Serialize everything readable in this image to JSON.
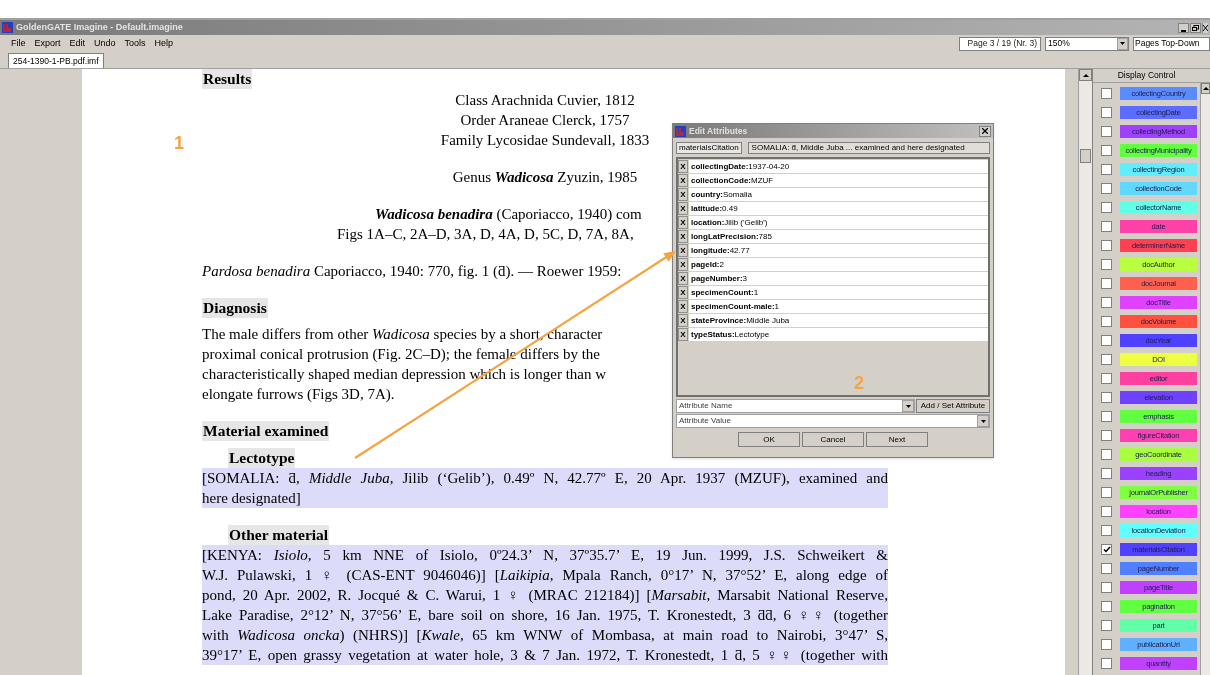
{
  "window": {
    "title": "GoldenGATE Imagine - Default.imagine"
  },
  "menu": [
    "File",
    "Export",
    "Edit",
    "Undo",
    "Tools",
    "Help"
  ],
  "toolbar": {
    "page_field": "Page 3 / 19 (Nr. 3)",
    "zoom": "150%",
    "layout": "Pages Top-Down"
  },
  "tabs": [
    {
      "label": "254-1390-1-PB.pdf.imf",
      "selected": true
    }
  ],
  "document": {
    "blocks": [
      {
        "kind": "heading",
        "lines": [
          "Results"
        ]
      },
      {
        "kind": "centered",
        "lines": [
          "Class Arachnida Cuvier, 1812",
          "Order Araneae Clerck, 1757",
          "Family Lycosidae Sundevall, 1833"
        ]
      },
      {
        "kind": "centered",
        "lines": [
          "Genus **Wadicosa** Zyuzin, 1985"
        ]
      },
      {
        "kind": "offset",
        "lines": [
          "**Wadicosa benadira** (Caporiacco, 1940) com",
          "Figs 1A–C, 2A–D, 3A, D, 4A, D, 5C, D, 7A, 8A,"
        ]
      },
      {
        "kind": "paragraph",
        "highlighted": false,
        "lines": [
          "*Pardosa benadira* Caporiacco, 1940: 770, fig. 1 (ƌ). — Roewer 1959:"
        ]
      },
      {
        "kind": "heading",
        "lines": [
          "Diagnosis"
        ]
      },
      {
        "kind": "paragraph",
        "highlighted": false,
        "lines": [
          "The male differs from other *Wadicosa* species by a short, character",
          "proximal conical protrusion (Fig. 2C–D); the female differs by the",
          "characteristically shaped median depression which is longer than w",
          "elongate furrows (Figs 3D, 7A)."
        ]
      },
      {
        "kind": "heading",
        "lines": [
          "Material examined"
        ]
      },
      {
        "kind": "subheading",
        "lines": [
          "Lectotype"
        ]
      },
      {
        "kind": "paragraph",
        "highlighted": true,
        "lines": [
          "[SOMALIA: ƌ, *Middle Juba*, Jilib (‘Gelib’), 0.49º N, 42.77º E, 20 Apr. 1937 (MZUF), examined and",
          "here designated]"
        ]
      },
      {
        "kind": "subheading",
        "lines": [
          "Other material"
        ]
      },
      {
        "kind": "paragraph",
        "highlighted": true,
        "lines": [
          "[KENYA: *Isiolo*, 5 km NNE of Isiolo, 0º24.3’ N, 37º35.7’ E, 19 Jun. 1999, J.S. Schweikert &",
          "W.J. Pulawski, 1 ♀ (CAS-ENT 9046046)] [*Laikipia*, Mpala Ranch, 0°17’ N, 37°52’ E, along edge of",
          "pond, 20 Apr. 2002, R. Jocqué & C. Warui, 1 ♀ (MRAC 212184)] [*Marsabit*, Marsabit National Reserve,",
          "Lake Paradise, 2°12’ N, 37°56’ E, bare soil on shore, 16 Jan. 1975, T. Kronestedt, 3 ƌƌ, 6 ♀♀ (together",
          "with *Wadicosa oncka*) (NHRS)] [*Kwale*, 65 km WNW of Mombasa, at main road to Nairobi, 3°47’ S,",
          "39°17’ E, open grassy vegetation at water hole, 3 & 7 Jan. 1972, T. Kronestedt, 1 ƌ, 5 ♀♀ (together with"
        ]
      }
    ]
  },
  "markers": [
    "1",
    "2"
  ],
  "dialog": {
    "title": "Edit Attributes",
    "annotation_type": "materialsCitation",
    "annotation_value": "SOMALIA: ƌ, Middle Juba ... examined and here designated",
    "attributes": [
      {
        "remove": "X",
        "name": "collectingDate:",
        "value": "1937-04-20"
      },
      {
        "remove": "X",
        "name": "collectionCode:",
        "value": "MZUF"
      },
      {
        "remove": "X",
        "name": "country:",
        "value": "Somalia"
      },
      {
        "remove": "X",
        "name": "latitude:",
        "value": "0.49"
      },
      {
        "remove": "X",
        "name": "location:",
        "value": "Jilib ('Gelib')"
      },
      {
        "remove": "X",
        "name": "longLatPrecision:",
        "value": "785"
      },
      {
        "remove": "X",
        "name": "longitude:",
        "value": "42.77"
      },
      {
        "remove": "X",
        "name": "pageId:",
        "value": "2"
      },
      {
        "remove": "X",
        "name": "pageNumber:",
        "value": "3"
      },
      {
        "remove": "X",
        "name": "specimenCount:",
        "value": "1"
      },
      {
        "remove": "X",
        "name": "specimenCount-male:",
        "value": "1"
      },
      {
        "remove": "X",
        "name": "stateProvince:",
        "value": "Middle Juba"
      },
      {
        "remove": "X",
        "name": "typeStatus:",
        "value": "Lectotype"
      }
    ],
    "name_placeholder": "Attribute Name",
    "value_placeholder": "Attribute Value",
    "add_button": "Add / Set Attribute",
    "buttons": [
      "OK",
      "Cancel",
      "Next"
    ]
  },
  "display_control": {
    "title": "Display Control",
    "items": [
      {
        "label": "collectingCountry",
        "color": "#5b8cff",
        "checked": false
      },
      {
        "label": "collectingDate",
        "color": "#5c6cff",
        "checked": false
      },
      {
        "label": "collectingMethod",
        "color": "#a040ff",
        "checked": false
      },
      {
        "label": "collectingMunicipality",
        "color": "#60ff40",
        "checked": false
      },
      {
        "label": "collectingRegion",
        "color": "#60eeff",
        "checked": false
      },
      {
        "label": "collectionCode",
        "color": "#60d8ff",
        "checked": false
      },
      {
        "label": "collectorName",
        "color": "#60ffe8",
        "checked": false
      },
      {
        "label": "date",
        "color": "#ff40a8",
        "checked": false
      },
      {
        "label": "determinerName",
        "color": "#ff4050",
        "checked": false
      },
      {
        "label": "docAuthor",
        "color": "#b8ff40",
        "checked": false
      },
      {
        "label": "docJournal",
        "color": "#ff6050",
        "checked": false
      },
      {
        "label": "docTitle",
        "color": "#e040ff",
        "checked": false
      },
      {
        "label": "docVolume",
        "color": "#ff5040",
        "checked": false
      },
      {
        "label": "docYear",
        "color": "#5040ff",
        "checked": false
      },
      {
        "label": "DOI",
        "color": "#ecff40",
        "checked": false
      },
      {
        "label": "editor",
        "color": "#ff40a0",
        "checked": false
      },
      {
        "label": "elevation",
        "color": "#7040ff",
        "checked": false
      },
      {
        "label": "emphasis",
        "color": "#60ff40",
        "checked": false
      },
      {
        "label": "figureCitation",
        "color": "#ff40b0",
        "checked": false
      },
      {
        "label": "geoCoordinate",
        "color": "#a8ff40",
        "checked": false
      },
      {
        "label": "heading",
        "color": "#9a40ff",
        "checked": false
      },
      {
        "label": "journalOrPublisher",
        "color": "#80ff40",
        "checked": false
      },
      {
        "label": "location",
        "color": "#ff40ff",
        "checked": false
      },
      {
        "label": "locationDeviation",
        "color": "#60ffff",
        "checked": false
      },
      {
        "label": "materialsCitation",
        "color": "#5040ff",
        "checked": true
      },
      {
        "label": "pageNumber",
        "color": "#5080ff",
        "checked": false
      },
      {
        "label": "pageTitle",
        "color": "#c040ff",
        "checked": false
      },
      {
        "label": "pagination",
        "color": "#60ff40",
        "checked": false
      },
      {
        "label": "part",
        "color": "#60ffa8",
        "checked": false
      },
      {
        "label": "publicationUrl",
        "color": "#60b0ff",
        "checked": false
      },
      {
        "label": "quantity",
        "color": "#c040ff",
        "checked": false
      }
    ]
  }
}
